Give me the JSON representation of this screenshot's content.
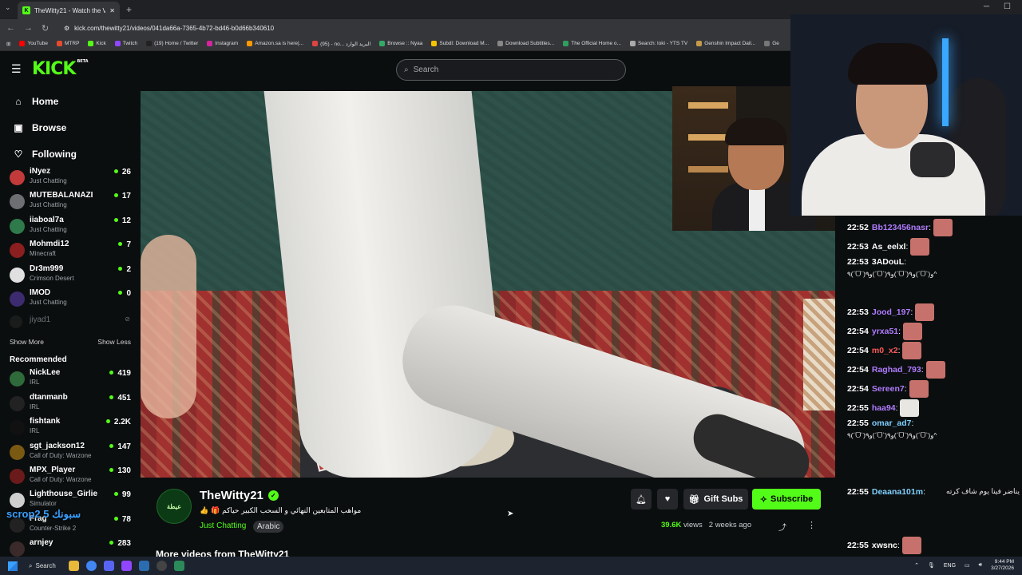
{
  "browser": {
    "tab_title": "TheWitty21 - Watch the Vi...",
    "url": "kick.com/thewitty21/videos/041da66a-7365-4b72-bd46-b0d66b340610",
    "bookmarks": [
      "YouTube",
      "MTRP",
      "Kick",
      "Twitch",
      "(19) Home / Twitter",
      "Instagram",
      "Amazon.sa is here|...",
      "(95) - no... البريد الوارد",
      "Browse :: Nyaa",
      "Subdl: Download M...",
      "Download Subtitles...",
      "The Official Home o...",
      "Search: loki - YTS TV",
      "Genshin Impact Dail...",
      "Ge"
    ]
  },
  "header": {
    "logo": "KICK",
    "logo_badge": "BETA",
    "search_placeholder": "Search"
  },
  "sidebar": {
    "nav": [
      {
        "label": "Home"
      },
      {
        "label": "Browse"
      },
      {
        "label": "Following"
      }
    ],
    "following": [
      {
        "name": "iNyez",
        "category": "Just Chatting",
        "viewers": "26",
        "color": "#c23a3a"
      },
      {
        "name": "MUTEBALANAZI",
        "category": "Just Chatting",
        "viewers": "17",
        "color": "#6d6f73"
      },
      {
        "name": "iiaboal7a",
        "category": "Just Chatting",
        "viewers": "12",
        "color": "#2f7a4a"
      },
      {
        "name": "Mohmdi12",
        "category": "Minecraft",
        "viewers": "7",
        "color": "#8b1e1e"
      },
      {
        "name": "Dr3m999",
        "category": "Crimson Desert",
        "viewers": "2",
        "color": "#e0e0e0"
      },
      {
        "name": "IMOD",
        "category": "Just Chatting",
        "viewers": "0",
        "color": "#3c2b6e"
      }
    ],
    "offline": {
      "name": "jiyad1"
    },
    "show_more": "Show More",
    "show_less": "Show Less",
    "recommended_title": "Recommended",
    "recommended": [
      {
        "name": "NickLee",
        "category": "IRL",
        "viewers": "419",
        "color": "#2f6a3a"
      },
      {
        "name": "dtanmanb",
        "category": "IRL",
        "viewers": "451",
        "color": "#222"
      },
      {
        "name": "fishtank",
        "category": "IRL",
        "viewers": "2.2K",
        "color": "#111"
      },
      {
        "name": "sgt_jackson12",
        "category": "Call of Duty: Warzone",
        "viewers": "147",
        "color": "#7a5a12"
      },
      {
        "name": "MPX_Player",
        "category": "Call of Duty: Warzone",
        "viewers": "130",
        "color": "#6a1a1a"
      },
      {
        "name": "Lighthouse_Girlie",
        "category": "Simulator",
        "viewers": "99",
        "color": "#cfcfcf"
      },
      {
        "name": "Frag",
        "category": "Counter-Strike 2",
        "viewers": "78",
        "color": "#222"
      },
      {
        "name": "arnjey",
        "category": "",
        "viewers": "283",
        "color": "#3a2a2a"
      }
    ]
  },
  "overlay_text": "scrop2 سبونك 5",
  "channel": {
    "avatar_text": "عيطة",
    "name": "TheWitty21",
    "title": "مواهب المتابعين النهائي و السحب الكبير حياكم 🎁 👍",
    "category": "Just Chatting",
    "tag": "Arabic",
    "views_value": "39.6K",
    "views_label": "views",
    "age": "2 weeks ago",
    "gift_label": "Gift Subs",
    "subscribe_label": "Subscribe",
    "more_videos": "More videos from TheWitty21"
  },
  "chat": {
    "messages": [
      {
        "time": "22:52",
        "user": "Bb123456nasr",
        "color": "#b07cff",
        "text": ""
      },
      {
        "time": "22:53",
        "user": "As_eelxl",
        "color": "#ffffff",
        "text": ""
      },
      {
        "time": "22:53",
        "user": "3ADouL",
        "color": "#ffffff",
        "text": "٩(ˊᗜˋ)و٩(ˊᗜˋ)و٩(ˊᗜˋ)و٩(ˊᗜˋ)و^"
      },
      {
        "time": "22:53",
        "user": "Jood_197",
        "color": "#b07cff",
        "text": ""
      },
      {
        "time": "22:54",
        "user": "yrxa51",
        "color": "#b07cff",
        "text": ""
      },
      {
        "time": "22:54",
        "user": "m0_x2",
        "color": "#ff5a5a",
        "text": ""
      },
      {
        "time": "22:54",
        "user": "Raghad_793",
        "color": "#b07cff",
        "text": ""
      },
      {
        "time": "22:54",
        "user": "Sereen7",
        "color": "#b07cff",
        "text": ""
      },
      {
        "time": "22:55",
        "user": "haa94",
        "color": "#b07cff",
        "text": ""
      },
      {
        "time": "22:55",
        "user": "omar_ad7",
        "color": "#7fd1ff",
        "text": "٩(ˊᗜˋ)و٩(ˊᗜˋ)و٩(ˊᗜˋ)و٩(ˊᗜˋ)و^"
      },
      {
        "time": "22:55",
        "user": "Deaana101m",
        "color": "#7fd1ff",
        "text": "يناضر فينا يوم شاف كرته"
      },
      {
        "time": "22:55",
        "user": "xwsnc",
        "color": "#ffffff",
        "text": ""
      }
    ]
  },
  "taskbar": {
    "search": "Search",
    "lang": "ENG",
    "time": "9:44 PM",
    "date": "3/27/2026"
  }
}
